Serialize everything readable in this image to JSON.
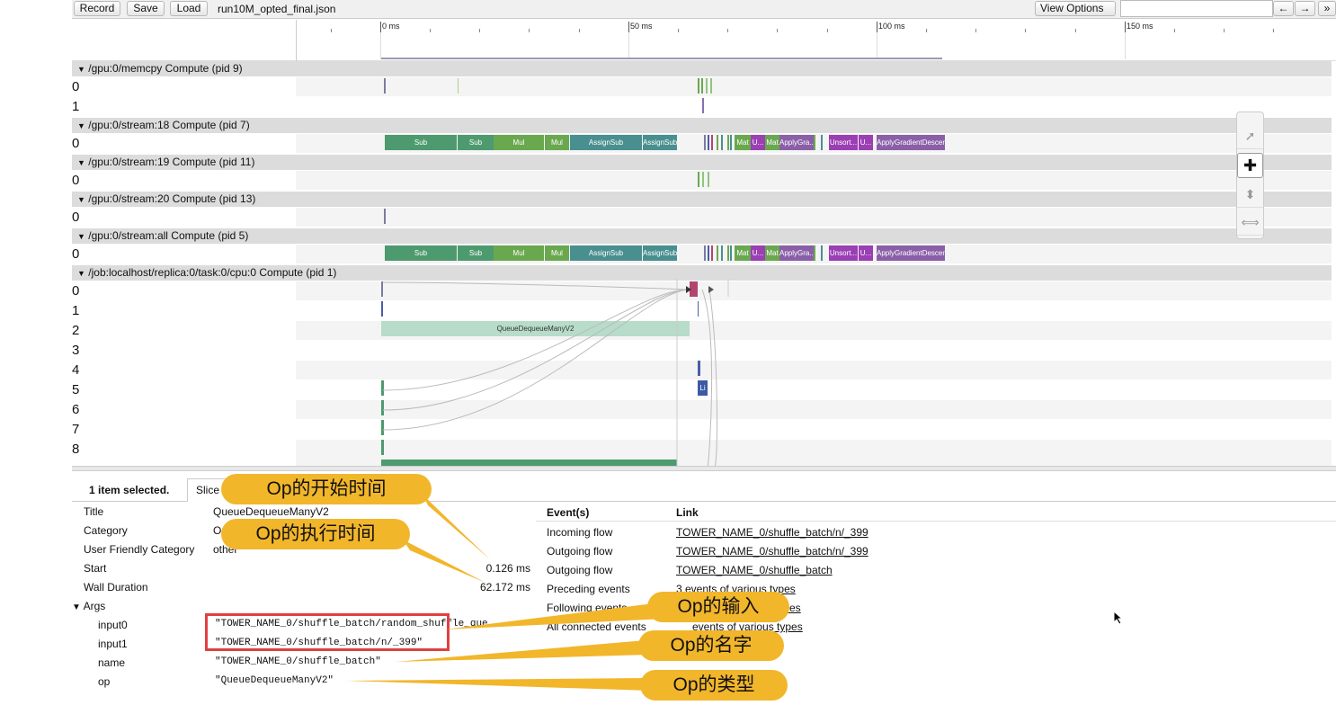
{
  "toolbar": {
    "record_label": "Record",
    "save_label": "Save",
    "load_label": "Load",
    "filename": "run10M_opted_final.json",
    "view_options_label": "View Options",
    "nav_left": "←",
    "nav_right": "→",
    "more": "»"
  },
  "ruler": {
    "labels": [
      "0 ms",
      "50 ms",
      "100 ms",
      "150 ms"
    ]
  },
  "processes": [
    {
      "label": "/gpu:0/memcpy Compute (pid 9)",
      "rows": [
        "0",
        "1"
      ]
    },
    {
      "label": "/gpu:0/stream:18 Compute (pid 7)",
      "rows": [
        "0"
      ]
    },
    {
      "label": "/gpu:0/stream:19 Compute (pid 11)",
      "rows": [
        "0"
      ]
    },
    {
      "label": "/gpu:0/stream:20 Compute (pid 13)",
      "rows": [
        "0"
      ]
    },
    {
      "label": "/gpu:0/stream:all Compute (pid 5)",
      "rows": [
        "0"
      ]
    },
    {
      "label": "/job:localhost/replica:0/task:0/cpu:0 Compute (pid 1)",
      "rows": [
        "0",
        "1",
        "2",
        "3",
        "4",
        "5",
        "6",
        "7",
        "8"
      ]
    }
  ],
  "slices": {
    "stream": [
      "Sub",
      "Sub",
      "Mul",
      "Mul",
      "AssignSub",
      "AssignSub",
      "Mat",
      "U...",
      "Mat",
      "ApplyGra...",
      "Unsort...",
      "U...",
      "ApplyGradientDescent"
    ],
    "cpu_queue": "QueueDequeueManyV2",
    "cpu_small": "Li"
  },
  "panel": {
    "selected_text": "1 item selected.",
    "tab_label": "Slice",
    "props": [
      {
        "key": "Title",
        "value": "QueueDequeueManyV2"
      },
      {
        "key": "Category",
        "value": "Op"
      },
      {
        "key": "User Friendly Category",
        "value": "other"
      },
      {
        "key": "Start",
        "value": "0.126 ms"
      },
      {
        "key": "Wall Duration",
        "value": "62.172 ms"
      }
    ],
    "args_label": "Args",
    "args": [
      {
        "key": "input0",
        "value": "\"TOWER_NAME_0/shuffle_batch/random_shuffle_que"
      },
      {
        "key": "input1",
        "value": "\"TOWER_NAME_0/shuffle_batch/n/_399\""
      },
      {
        "key": "name",
        "value": "\"TOWER_NAME_0/shuffle_batch\""
      },
      {
        "key": "op",
        "value": "\"QueueDequeueManyV2\""
      }
    ],
    "events_header": "Event(s)",
    "link_header": "Link",
    "events": [
      {
        "event": "Incoming flow",
        "link": "TOWER_NAME_0/shuffle_batch/n/_399"
      },
      {
        "event": "Outgoing flow",
        "link": "TOWER_NAME_0/shuffle_batch/n/_399"
      },
      {
        "event": "Outgoing flow",
        "link": "TOWER_NAME_0/shuffle_batch"
      },
      {
        "event": "Preceding events",
        "link": "3 events of various types"
      },
      {
        "event": "Following events",
        "link": "types"
      },
      {
        "event": "All connected events",
        "link": "events of various types"
      }
    ]
  },
  "callouts": {
    "start": "Op的开始时间",
    "duration": "Op的执行时间",
    "input": "Op的输入",
    "name": "Op的名字",
    "type": "Op的类型"
  },
  "colors": {
    "callout": "#f2b62b",
    "highlight_box": "#e04040",
    "sub": "#4d9a6f",
    "mul": "#6aa84f",
    "assign": "#4a8f8f",
    "purple": "#9b3fb5",
    "apply": "#8a5fa8"
  }
}
